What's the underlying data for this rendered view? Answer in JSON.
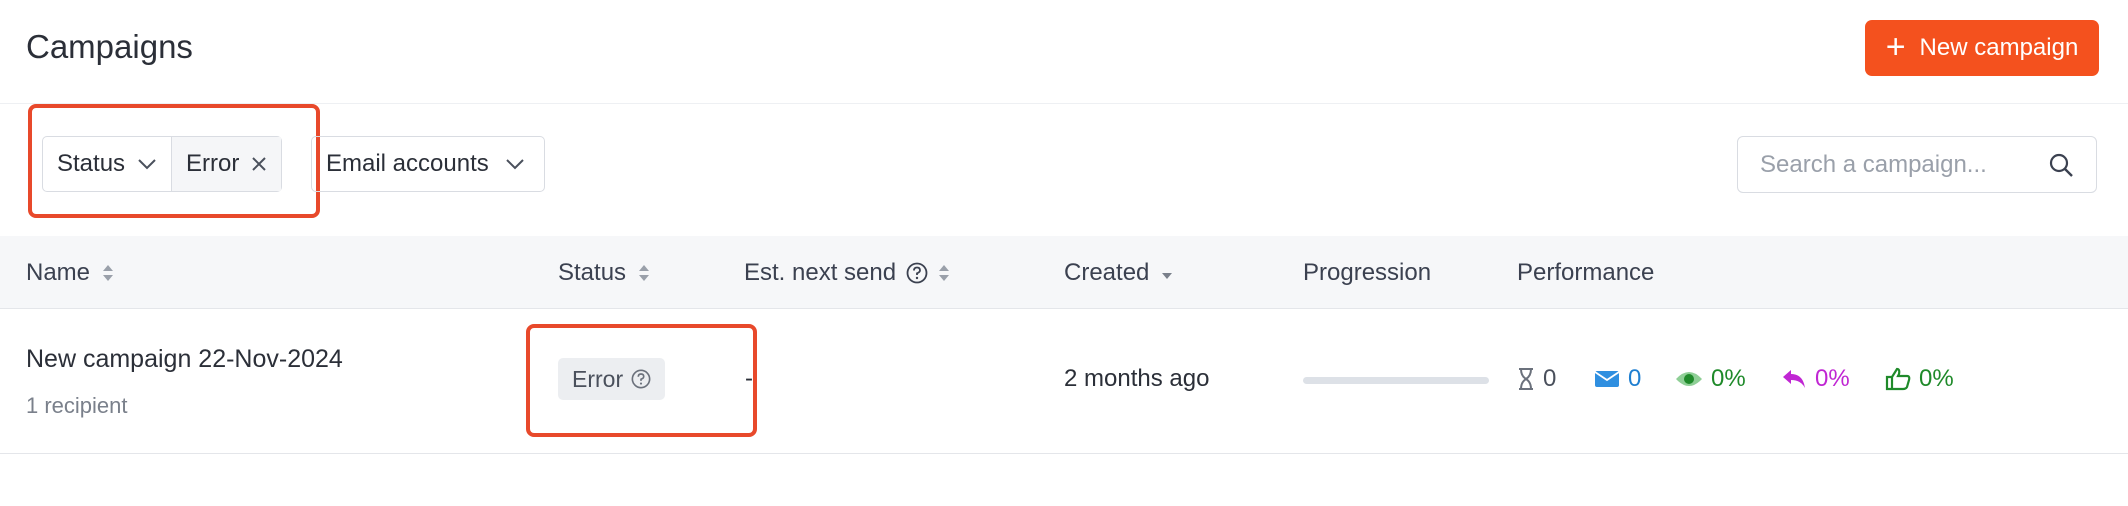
{
  "header": {
    "title": "Campaigns",
    "new_campaign_label": "New campaign"
  },
  "filters": {
    "status_label": "Status",
    "status_value": "Error",
    "email_accounts_label": "Email accounts"
  },
  "search": {
    "placeholder": "Search a campaign..."
  },
  "table": {
    "columns": {
      "name": "Name",
      "status": "Status",
      "est_next_send": "Est. next send",
      "created": "Created",
      "progression": "Progression",
      "performance": "Performance"
    },
    "rows": [
      {
        "name": "New campaign 22-Nov-2024",
        "recipients": "1 recipient",
        "status": "Error",
        "est_next_send": "-",
        "created": "2 months ago",
        "progression": 0,
        "performance": {
          "pending": "0",
          "sent": "0",
          "opened": "0%",
          "replied": "0%",
          "interested": "0%"
        }
      }
    ]
  },
  "colors": {
    "accent": "#f4511e",
    "highlight": "#e8492b",
    "sent": "#1f7fd1",
    "opened": "#1f8a2a",
    "replied": "#c026d3",
    "interested": "#1f8a2a"
  },
  "icons": [
    "plus-icon",
    "chevron-down-icon",
    "close-icon",
    "search-icon",
    "sort-icon",
    "help-icon",
    "hourglass-icon",
    "mail-icon",
    "eye-icon",
    "reply-icon",
    "thumbs-up-icon"
  ]
}
